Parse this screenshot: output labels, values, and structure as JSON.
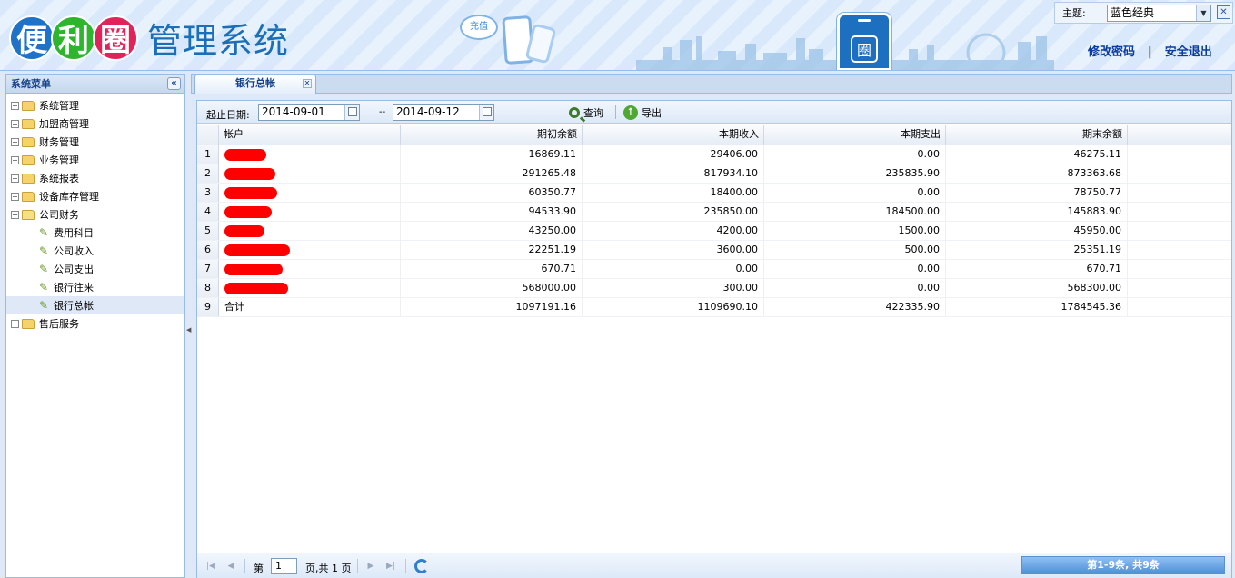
{
  "header": {
    "logo_chars": [
      "便",
      "利",
      "圈"
    ],
    "system_name": "管理系统",
    "cloud_text": "充值",
    "badge_char": "圈",
    "theme_label": "主题:",
    "theme_value": "蓝色经典",
    "change_password": "修改密码",
    "link_separator": "|",
    "logout": "安全退出"
  },
  "sidebar": {
    "title": "系统菜单",
    "items": [
      {
        "label": "系统管理",
        "type": "folder",
        "expanded": false
      },
      {
        "label": "加盟商管理",
        "type": "folder",
        "expanded": false
      },
      {
        "label": "财务管理",
        "type": "folder",
        "expanded": false
      },
      {
        "label": "业务管理",
        "type": "folder",
        "expanded": false
      },
      {
        "label": "系统报表",
        "type": "folder",
        "expanded": false
      },
      {
        "label": "设备库存管理",
        "type": "folder",
        "expanded": false
      },
      {
        "label": "公司财务",
        "type": "folder",
        "expanded": true
      },
      {
        "label": "费用科目",
        "type": "leaf"
      },
      {
        "label": "公司收入",
        "type": "leaf"
      },
      {
        "label": "公司支出",
        "type": "leaf"
      },
      {
        "label": "银行往来",
        "type": "leaf"
      },
      {
        "label": "银行总帐",
        "type": "leaf",
        "selected": true
      },
      {
        "label": "售后服务",
        "type": "folder",
        "expanded": false
      }
    ]
  },
  "tab": {
    "label": "银行总帐"
  },
  "toolbar": {
    "date_label": "起止日期:",
    "start_date": "2014-09-01",
    "separator": "--",
    "end_date": "2014-09-12",
    "query_label": "查询",
    "export_label": "导出"
  },
  "grid": {
    "columns": [
      "帐户",
      "期初余额",
      "本期收入",
      "本期支出",
      "期末余额"
    ],
    "rows": [
      {
        "n": "1",
        "account": "",
        "opening": "16869.11",
        "income": "29406.00",
        "expense": "0.00",
        "closing": "46275.11"
      },
      {
        "n": "2",
        "account": "",
        "opening": "291265.48",
        "income": "817934.10",
        "expense": "235835.90",
        "closing": "873363.68"
      },
      {
        "n": "3",
        "account": "",
        "opening": "60350.77",
        "income": "18400.00",
        "expense": "0.00",
        "closing": "78750.77"
      },
      {
        "n": "4",
        "account": "",
        "opening": "94533.90",
        "income": "235850.00",
        "expense": "184500.00",
        "closing": "145883.90"
      },
      {
        "n": "5",
        "account": "",
        "opening": "43250.00",
        "income": "4200.00",
        "expense": "1500.00",
        "closing": "45950.00"
      },
      {
        "n": "6",
        "account": "",
        "opening": "22251.19",
        "income": "3600.00",
        "expense": "500.00",
        "closing": "25351.19"
      },
      {
        "n": "7",
        "account": "",
        "opening": "670.71",
        "income": "0.00",
        "expense": "0.00",
        "closing": "670.71"
      },
      {
        "n": "8",
        "account": "",
        "opening": "568000.00",
        "income": "300.00",
        "expense": "0.00",
        "closing": "568300.00"
      },
      {
        "n": "9",
        "account": "合计",
        "opening": "1097191.16",
        "income": "1109690.10",
        "expense": "422335.90",
        "closing": "1784545.36"
      }
    ]
  },
  "pager": {
    "page_prefix": "第",
    "page_value": "1",
    "page_suffix": "页,共 1 页",
    "info": "第1-9条, 共9条"
  }
}
